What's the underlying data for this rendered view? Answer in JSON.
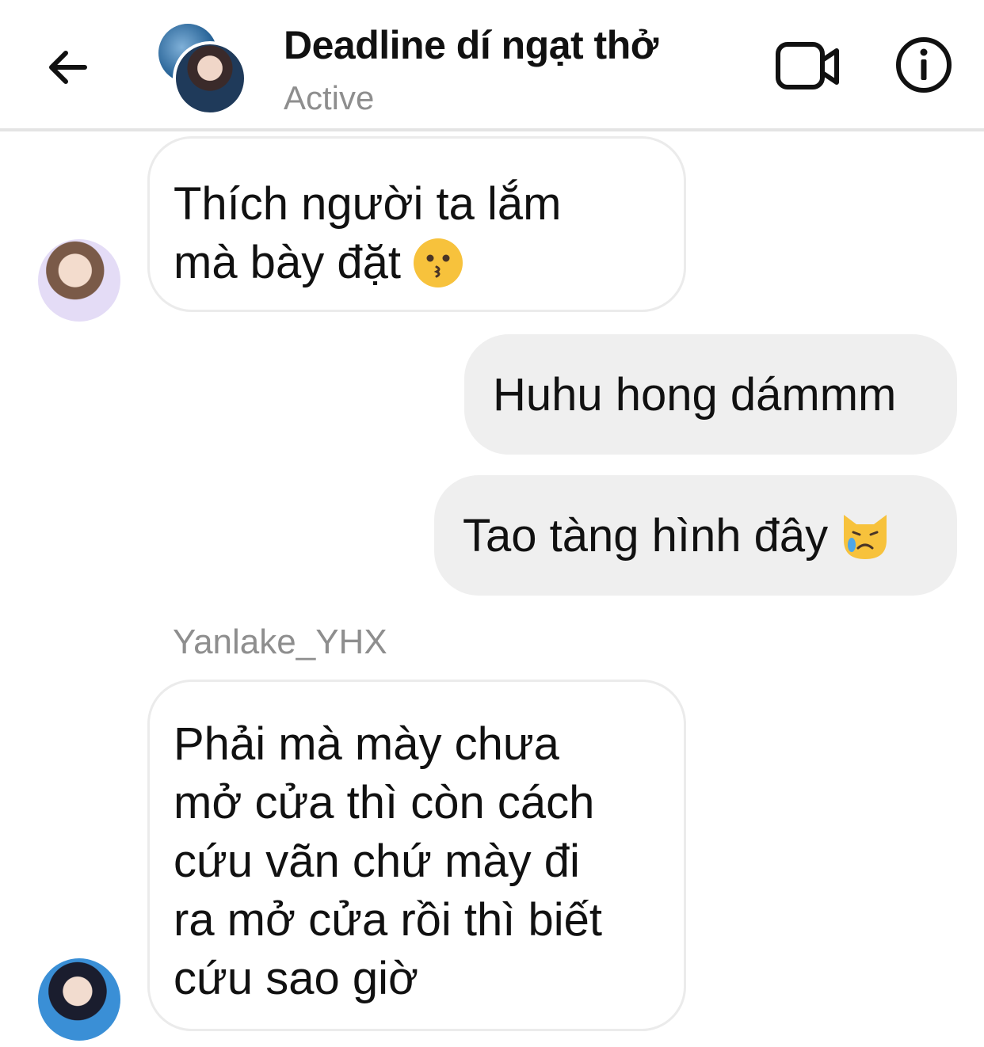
{
  "header": {
    "title": "Deadline dí ngạt thở",
    "status": "Active"
  },
  "messages": {
    "m1": {
      "lines": [
        "Thích người ta lắm",
        "mà bày đặt"
      ],
      "emoji": "kissing-face"
    },
    "m2": {
      "lines": [
        "Huhu hong dámmm"
      ]
    },
    "m3": {
      "lines": [
        "Tao tàng hình đây"
      ],
      "emoji": "crying-cat-face"
    },
    "m4": {
      "sender": "Yanlake_YHX",
      "lines": [
        "Phải mà mày chưa",
        "mở cửa thì còn cách",
        "cứu vãn chứ mày đi",
        "ra mở cửa rồi thì biết",
        "cứu sao giờ"
      ]
    }
  },
  "colors": {
    "incoming_bg": "#ffffff",
    "outgoing_bg": "#efefef",
    "muted_text": "#8e8e8e"
  },
  "icons": [
    "back-arrow-icon",
    "video-call-icon",
    "info-icon"
  ]
}
